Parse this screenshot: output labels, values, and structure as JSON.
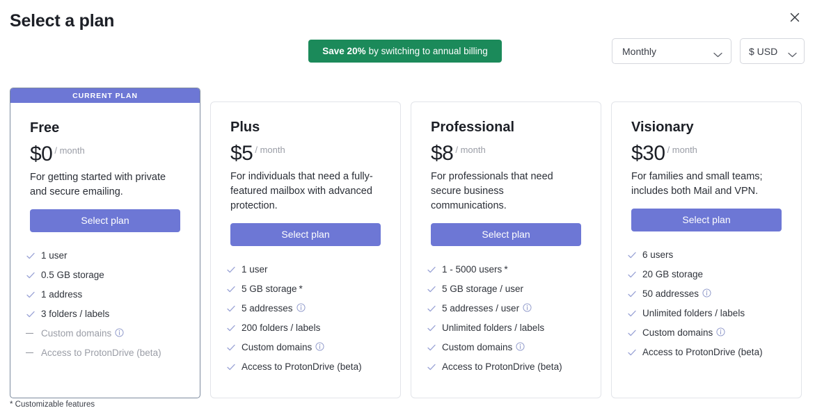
{
  "header": {
    "title": "Select a plan",
    "close_icon": "close-icon"
  },
  "promo": {
    "strong": "Save 20%",
    "rest": "by switching to annual billing"
  },
  "controls": {
    "cycle": {
      "value": "Monthly",
      "icon": "chevron-down-icon"
    },
    "currency": {
      "value": "$ USD",
      "icon": "chevron-down-icon"
    }
  },
  "colors": {
    "accent": "#6d77d5",
    "promo_green": "#1b8a5a",
    "current_border": "#7c8a9e",
    "card_border": "#e2e4e9",
    "muted_text": "#9a9da6"
  },
  "footnote": "* Customizable features",
  "plans": [
    {
      "badge": "CURRENT PLAN",
      "current": true,
      "name": "Free",
      "price": "$0",
      "cycle": "/ month",
      "description": "For getting started with private and secure emailing.",
      "cta": "Select plan",
      "features": [
        {
          "label": "1 user",
          "enabled": true,
          "info": false,
          "star": false
        },
        {
          "label": "0.5 GB storage",
          "enabled": true,
          "info": false,
          "star": false
        },
        {
          "label": "1 address",
          "enabled": true,
          "info": false,
          "star": false
        },
        {
          "label": "3 folders / labels",
          "enabled": true,
          "info": false,
          "star": false
        },
        {
          "label": "Custom domains",
          "enabled": false,
          "info": true,
          "star": false
        },
        {
          "label": "Access to ProtonDrive (beta)",
          "enabled": false,
          "info": false,
          "star": false
        }
      ]
    },
    {
      "badge": "",
      "current": false,
      "name": "Plus",
      "price": "$5",
      "cycle": "/ month",
      "description": "For individuals that need a fully-featured mailbox with advanced protection.",
      "cta": "Select plan",
      "features": [
        {
          "label": "1 user",
          "enabled": true,
          "info": false,
          "star": false
        },
        {
          "label": "5 GB storage",
          "enabled": true,
          "info": false,
          "star": true
        },
        {
          "label": "5 addresses",
          "enabled": true,
          "info": true,
          "star": false
        },
        {
          "label": "200 folders / labels",
          "enabled": true,
          "info": false,
          "star": false
        },
        {
          "label": "Custom domains",
          "enabled": true,
          "info": true,
          "star": false
        },
        {
          "label": "Access to ProtonDrive (beta)",
          "enabled": true,
          "info": false,
          "star": false
        }
      ]
    },
    {
      "badge": "",
      "current": false,
      "name": "Professional",
      "price": "$8",
      "cycle": "/ month",
      "description": "For professionals that need secure business communications.",
      "cta": "Select plan",
      "features": [
        {
          "label": "1 - 5000 users",
          "enabled": true,
          "info": false,
          "star": true
        },
        {
          "label": "5 GB storage / user",
          "enabled": true,
          "info": false,
          "star": false
        },
        {
          "label": "5 addresses / user",
          "enabled": true,
          "info": true,
          "star": false
        },
        {
          "label": "Unlimited folders / labels",
          "enabled": true,
          "info": false,
          "star": false
        },
        {
          "label": "Custom domains",
          "enabled": true,
          "info": true,
          "star": false
        },
        {
          "label": "Access to ProtonDrive (beta)",
          "enabled": true,
          "info": false,
          "star": false
        }
      ]
    },
    {
      "badge": "",
      "current": false,
      "name": "Visionary",
      "price": "$30",
      "cycle": "/ month",
      "description": "For families and small teams; includes both Mail and VPN.",
      "cta": "Select plan",
      "features": [
        {
          "label": "6 users",
          "enabled": true,
          "info": false,
          "star": false
        },
        {
          "label": "20 GB storage",
          "enabled": true,
          "info": false,
          "star": false
        },
        {
          "label": "50 addresses",
          "enabled": true,
          "info": true,
          "star": false
        },
        {
          "label": "Unlimited folders / labels",
          "enabled": true,
          "info": false,
          "star": false
        },
        {
          "label": "Custom domains",
          "enabled": true,
          "info": true,
          "star": false
        },
        {
          "label": "Access to ProtonDrive (beta)",
          "enabled": true,
          "info": false,
          "star": false
        }
      ]
    }
  ]
}
